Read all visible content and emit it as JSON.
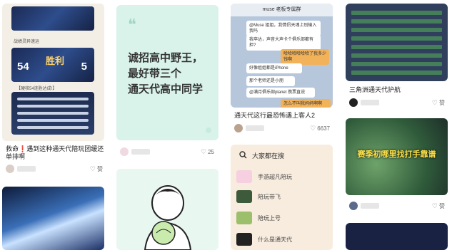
{
  "feed": {
    "col1": {
      "screenshot_header": "战绩灵异速运",
      "victory_left": "54",
      "victory_right": "5",
      "victory_word": "胜利",
      "mid_note": "【硬核54连胜达成!】",
      "title": "救命❗️遇到这种通天代陪玩团缓还单排啊",
      "like_label": "赞"
    },
    "col2": {
      "quote_mark": "❝",
      "headline_line1": "诚招高中野王，",
      "headline_line2": "最好带三个",
      "headline_line3": "通天代高中同学",
      "likes": "25"
    },
    "col3": {
      "chat_title": "muse 老板专属群",
      "chat_lines": [
        "@Muse 姐姐，我情侣天魂上别输入我吗",
        "我卒达，声音大声卡个俱乐部都有担?",
        "哈哈哈哈哈哈了我多少钱啊",
        "好像姐姐都是iPhone",
        "那个老师还是小朋",
        "@满月俱乐部planet 携票直说",
        "怎么不叫我妈妈啊啊"
      ],
      "title": "通天代这行最恐怖遇上客人2",
      "likes": "6637",
      "search": {
        "heading": "大家都在搜",
        "items": [
          "手游超凡陪玩",
          "陪玩带飞",
          "陪玩上号",
          "什么是通天代"
        ]
      }
    },
    "col4": {
      "title": "三角洲通天代护航",
      "like_label": "赞",
      "banner": "赛季初哪里找打手靠谱",
      "like_label2": "赞"
    }
  },
  "colors": {
    "mint": "#d9f3ea",
    "accent": "#f2b25a",
    "search_bg": "#f8ecde"
  }
}
